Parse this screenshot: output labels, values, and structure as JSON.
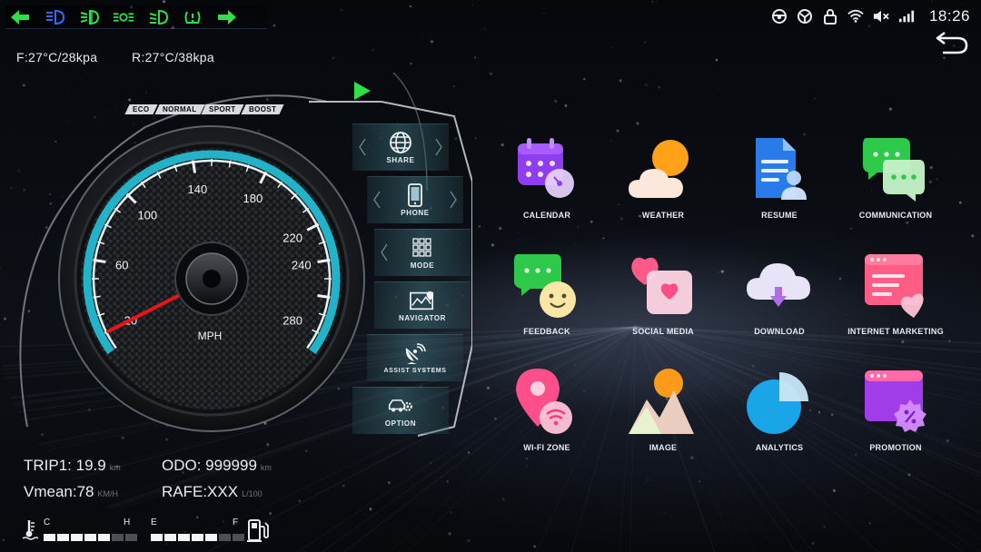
{
  "status_bar": {
    "left_icons": [
      {
        "name": "left-arrow-icon",
        "color": "#2ee046"
      },
      {
        "name": "high-beam-icon",
        "color": "#2f6bff"
      },
      {
        "name": "fog-light-icon",
        "color": "#2ee046"
      },
      {
        "name": "side-lights-icon",
        "color": "#2ee046"
      },
      {
        "name": "low-beam-icon",
        "color": "#2ee046"
      },
      {
        "name": "tire-pressure-icon",
        "color": "#2ee046"
      },
      {
        "name": "right-arrow-icon",
        "color": "#2ee046"
      }
    ],
    "system_icons": [
      "steering-wheel-icon",
      "steering-wheel-alt-icon",
      "lock-icon",
      "wifi-icon",
      "mute-icon",
      "signal-icon"
    ],
    "time": "18:26"
  },
  "tires": {
    "front": "F:27°C/28kpa",
    "rear": "R:27°C/38kpa"
  },
  "drive_modes": [
    "ECO",
    "NORMAL",
    "SPORT",
    "BOOST"
  ],
  "speedometer": {
    "unit": "MPH",
    "tick_labels": [
      "20",
      "60",
      "100",
      "140",
      "180",
      "220",
      "240",
      "280"
    ],
    "needle_value": 20
  },
  "menu": [
    {
      "label": "SHARE",
      "icon": "globe-icon"
    },
    {
      "label": "PHONE",
      "icon": "phone-icon"
    },
    {
      "label": "MODE",
      "icon": "grid-icon"
    },
    {
      "label": "NAVIGATOR",
      "icon": "map-icon"
    },
    {
      "label": "ASSIST SYSTEMS",
      "icon": "satellite-dish-icon"
    },
    {
      "label": "OPTION",
      "icon": "car-gear-icon"
    }
  ],
  "apps": [
    {
      "label": "CALENDAR",
      "icon": "calendar-icon"
    },
    {
      "label": "WEATHER",
      "icon": "weather-icon"
    },
    {
      "label": "RESUME",
      "icon": "resume-icon"
    },
    {
      "label": "COMMUNICATION",
      "icon": "chat-bubbles-icon"
    },
    {
      "label": "FEEDBACK",
      "icon": "feedback-icon"
    },
    {
      "label": "SOCIAL MEDIA",
      "icon": "social-media-icon"
    },
    {
      "label": "DOWNLOAD",
      "icon": "cloud-download-icon"
    },
    {
      "label": "INTERNET MARKETING",
      "icon": "internet-marketing-icon"
    },
    {
      "label": "WI-FI ZONE",
      "icon": "wifi-zone-icon"
    },
    {
      "label": "IMAGE",
      "icon": "image-icon"
    },
    {
      "label": "ANALYTICS",
      "icon": "pie-chart-icon"
    },
    {
      "label": "PROMOTION",
      "icon": "promotion-icon"
    }
  ],
  "trip": {
    "trip1_label": "TRIP1: 19.9",
    "trip1_unit": "km",
    "odo_label": "ODO: 999999",
    "odo_unit": "km",
    "vmean_label": "Vmean:78",
    "vmean_unit": "KM/H",
    "rafe_label": "RAFE:XXX",
    "rafe_unit": "L/100"
  },
  "temperature_gauge": {
    "low": "C",
    "high": "H",
    "level": 5,
    "segments": 7
  },
  "fuel_gauge": {
    "low": "E",
    "high": "F",
    "level": 5,
    "segments": 7
  }
}
